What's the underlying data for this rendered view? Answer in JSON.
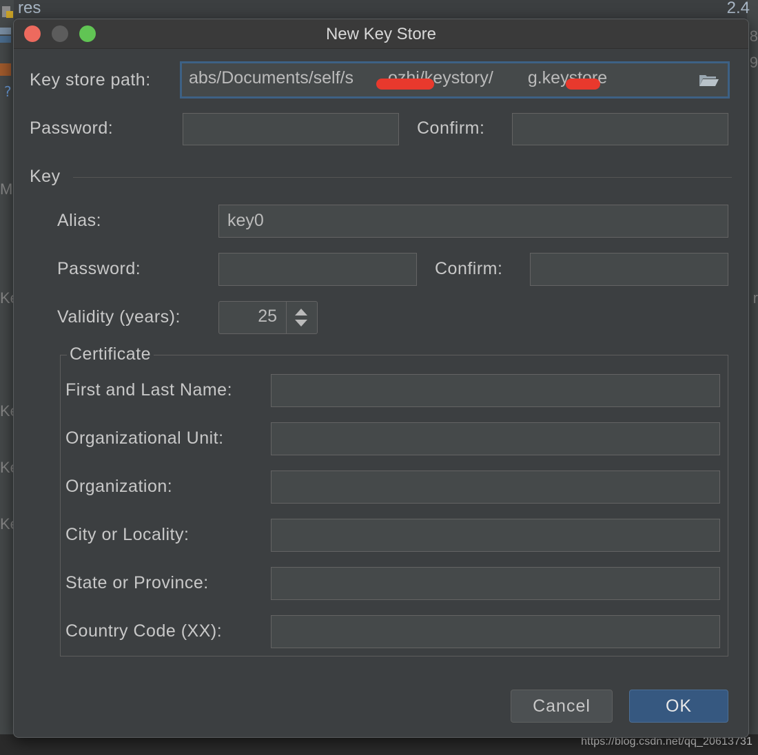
{
  "background": {
    "top_left_text": "res",
    "top_right_text": "2.4",
    "right_fragments": [
      "8",
      "9"
    ],
    "left_fragments": [
      "M",
      "Ke",
      "Ke",
      "Ke",
      "Ke"
    ],
    "right_fragment_r": "r",
    "watermark": "https://blog.csdn.net/qq_20613731"
  },
  "dialog": {
    "title": "New Key Store",
    "keystore": {
      "path_label": "Key store path:",
      "path_value": "abs/Documents/self/s  ozhi/keystory/  g.keystore",
      "password_label": "Password:",
      "password_value": "",
      "confirm_label": "Confirm:",
      "confirm_value": ""
    },
    "key": {
      "section_label": "Key",
      "alias_label": "Alias:",
      "alias_value": "key0",
      "password_label": "Password:",
      "password_value": "",
      "confirm_label": "Confirm:",
      "confirm_value": "",
      "validity_label": "Validity (years):",
      "validity_value": "25"
    },
    "certificate": {
      "title": "Certificate",
      "fields": [
        {
          "label": "First and Last Name:",
          "value": ""
        },
        {
          "label": "Organizational Unit:",
          "value": ""
        },
        {
          "label": "Organization:",
          "value": ""
        },
        {
          "label": "City or Locality:",
          "value": ""
        },
        {
          "label": "State or Province:",
          "value": ""
        },
        {
          "label": "Country Code (XX):",
          "value": ""
        }
      ]
    },
    "buttons": {
      "cancel": "Cancel",
      "ok": "OK"
    }
  },
  "colors": {
    "dialog_bg": "#3c3f41",
    "field_bg": "#45494a",
    "focus_border": "#3d6185",
    "ok_button": "#365880",
    "redaction": "#e8392d"
  },
  "icons": {
    "folder": "folder-open-icon",
    "spinner": "spinner-arrows-icon"
  }
}
